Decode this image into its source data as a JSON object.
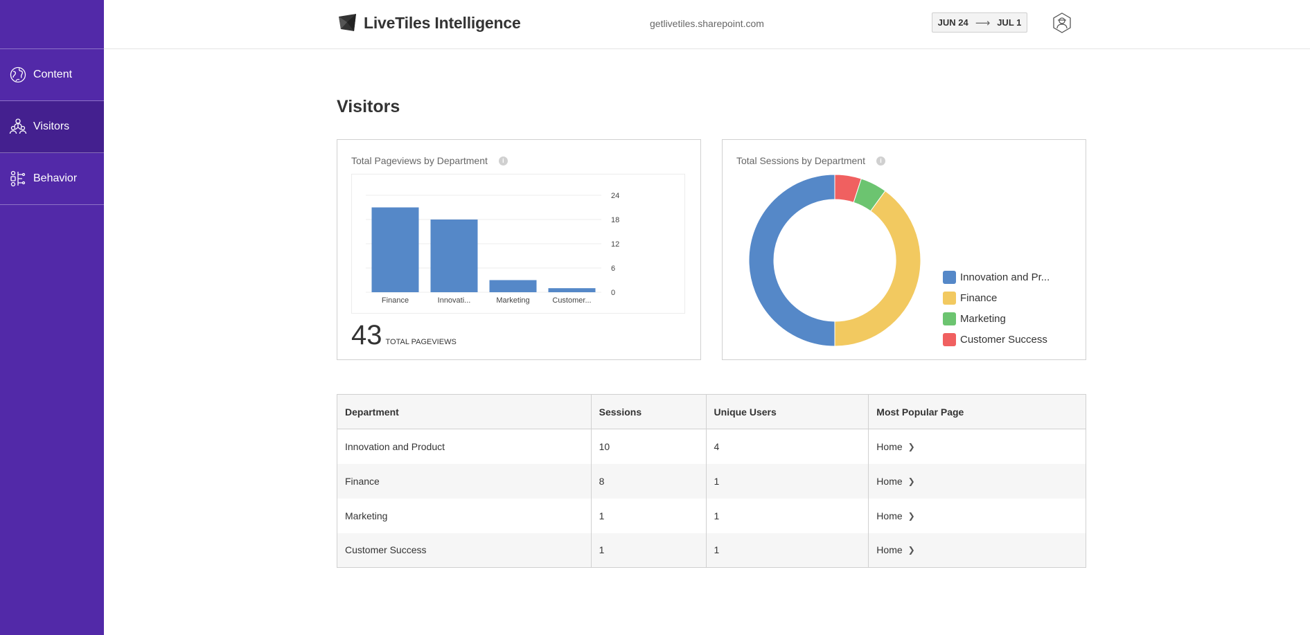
{
  "app": {
    "name": "LiveTiles Intelligence",
    "site": "getlivetiles.sharepoint.com",
    "date_start": "JUN 24",
    "date_end": "JUL 1"
  },
  "sidebar": {
    "items": [
      {
        "label": "Content",
        "icon": "globe-icon",
        "active": false
      },
      {
        "label": "Visitors",
        "icon": "people-icon",
        "active": true
      },
      {
        "label": "Behavior",
        "icon": "flow-icon",
        "active": false
      }
    ]
  },
  "page": {
    "title": "Visitors"
  },
  "pageviews_card": {
    "title": "Total Pageviews by Department",
    "info": "i",
    "total_value": "43",
    "total_label": "TOTAL PAGEVIEWS"
  },
  "sessions_card": {
    "title": "Total Sessions by Department",
    "info": "i",
    "legend": [
      {
        "label": "Innovation and Pr...",
        "color": "#5588c8"
      },
      {
        "label": "Finance",
        "color": "#f2c960"
      },
      {
        "label": "Marketing",
        "color": "#6cc470"
      },
      {
        "label": "Customer Success",
        "color": "#f06060"
      }
    ]
  },
  "chart_data": [
    {
      "type": "bar",
      "title": "Total Pageviews by Department",
      "categories": [
        "Finance",
        "Innovati...",
        "Marketing",
        "Customer..."
      ],
      "values": [
        21,
        18,
        3,
        1
      ],
      "ylim": [
        0,
        24
      ],
      "yticks": [
        0,
        6,
        12,
        18,
        24
      ],
      "color": "#5588c8",
      "grid": true
    },
    {
      "type": "pie",
      "title": "Total Sessions by Department",
      "donut": true,
      "labels": [
        "Innovation and Product",
        "Finance",
        "Marketing",
        "Customer Success"
      ],
      "values": [
        10,
        8,
        1,
        1
      ],
      "colors": [
        "#5588c8",
        "#f2c960",
        "#6cc470",
        "#f06060"
      ],
      "legend": "right"
    }
  ],
  "table": {
    "headers": [
      "Department",
      "Sessions",
      "Unique Users",
      "Most Popular Page"
    ],
    "rows": [
      [
        "Innovation and Product",
        "10",
        "4",
        "Home"
      ],
      [
        "Finance",
        "8",
        "1",
        "Home"
      ],
      [
        "Marketing",
        "1",
        "1",
        "Home"
      ],
      [
        "Customer Success",
        "1",
        "1",
        "Home"
      ]
    ]
  }
}
